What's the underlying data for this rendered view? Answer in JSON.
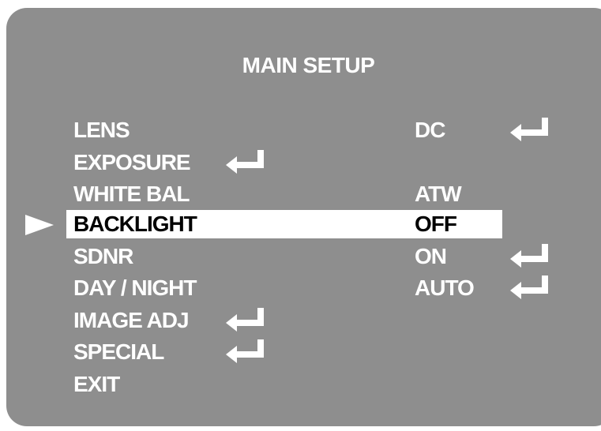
{
  "menu": {
    "title": "MAIN SETUP",
    "items": [
      {
        "label": "LENS",
        "value": "DC",
        "label_enter": false,
        "value_enter": true,
        "selected": false
      },
      {
        "label": "EXPOSURE",
        "value": "",
        "label_enter": true,
        "value_enter": false,
        "selected": false
      },
      {
        "label": "WHITE BAL",
        "value": "ATW",
        "label_enter": false,
        "value_enter": false,
        "selected": false
      },
      {
        "label": "BACKLIGHT",
        "value": "OFF",
        "label_enter": false,
        "value_enter": false,
        "selected": true
      },
      {
        "label": "SDNR",
        "value": "ON",
        "label_enter": false,
        "value_enter": true,
        "selected": false
      },
      {
        "label": "DAY / NIGHT",
        "value": "AUTO",
        "label_enter": false,
        "value_enter": true,
        "selected": false
      },
      {
        "label": "IMAGE ADJ",
        "value": "",
        "label_enter": true,
        "value_enter": false,
        "selected": false
      },
      {
        "label": "SPECIAL",
        "value": "",
        "label_enter": true,
        "value_enter": false,
        "selected": false
      },
      {
        "label": "EXIT",
        "value": "",
        "label_enter": false,
        "value_enter": false,
        "selected": false
      }
    ]
  },
  "icons": {
    "submenu": "enter-arrow-icon",
    "cursor": "selection-pointer-icon"
  },
  "colors": {
    "panel_background": "#8e8e8e",
    "text": "#ffffff",
    "highlight": "#ffffff",
    "highlight_text": "#000000"
  }
}
